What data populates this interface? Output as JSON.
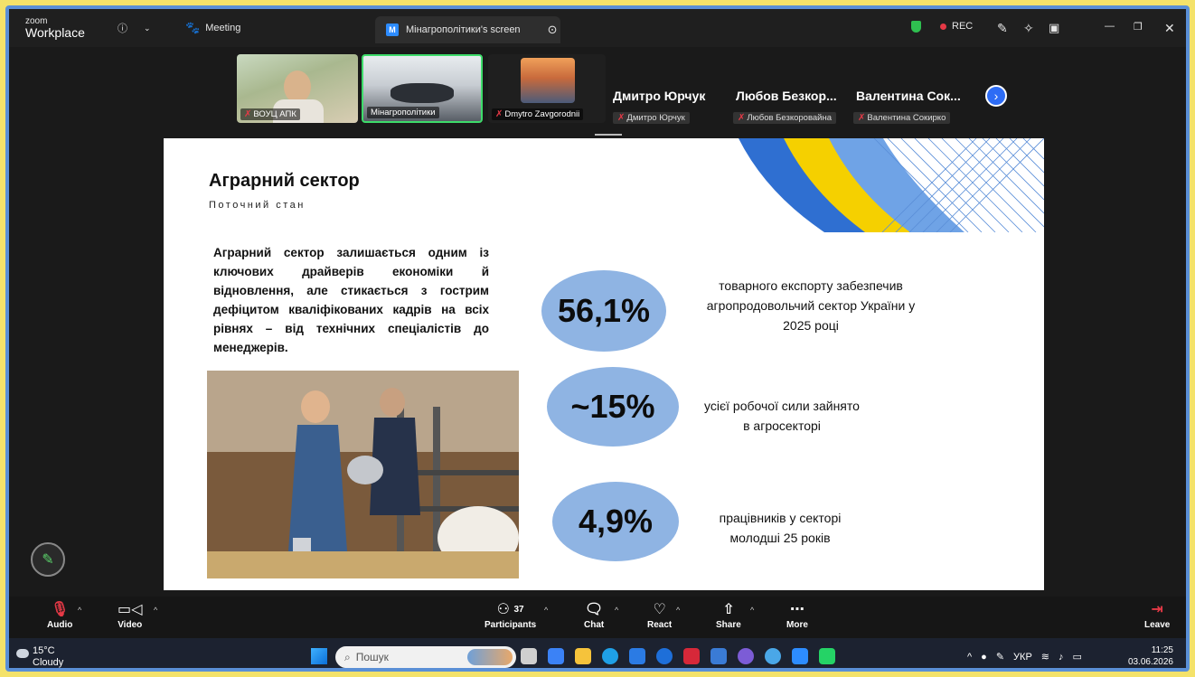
{
  "titlebar": {
    "logo_small": "zoom",
    "logo_big": "Workplace",
    "meeting_tab": "Meeting",
    "active_tab": "Мінагрополітики's screen",
    "rec_label": "REC"
  },
  "participants": {
    "thumbs": [
      {
        "name": "ВОУЦ АПК"
      },
      {
        "name": "Мінагрополітики"
      },
      {
        "name": "Dmytro Zavgorodnii"
      }
    ],
    "name_only": [
      {
        "title": "Дмитро Юрчук",
        "tag": "Дмитро Юрчук"
      },
      {
        "title": "Любов Безкор...",
        "tag": "Любов Безкоровайна"
      },
      {
        "title": "Валентина Сок...",
        "tag": "Валентина Сокирко"
      }
    ]
  },
  "slide": {
    "title": "Аграрний сектор",
    "subtitle": "Поточний стан",
    "body": "Аграрний сектор залишається одним із ключових драйверів економіки й відновлення, але стикається з гострим дефіцитом кваліфікованих кадрів на всіх рівнях – від технічних спеціалістів до менеджерів.",
    "stats": [
      {
        "value": "56,1%",
        "line1": "товарного експорту забезпечив",
        "line2": "агропродовольчий сектор України у",
        "line3": "2025 році"
      },
      {
        "value": "~15%",
        "line1": "усієї робочої сили зайнято",
        "line2": "в агросекторі"
      },
      {
        "value": "4,9%",
        "line1": "працівників у секторі",
        "line2": "молодші 25 років"
      }
    ],
    "accent_colors": {
      "blue": "#2f6fd1",
      "yellow": "#f5d000",
      "bubble": "#8fb4e3"
    }
  },
  "toolbar": {
    "audio": "Audio",
    "video": "Video",
    "participants": "Participants",
    "participants_count": "37",
    "chat": "Chat",
    "react": "React",
    "share": "Share",
    "more": "More",
    "leave": "Leave"
  },
  "taskbar": {
    "temp": "15°C",
    "weather": "Cloudy",
    "search_placeholder": "Пошук",
    "lang": "УКР",
    "time": "11:25",
    "date": "03.06.2026"
  }
}
